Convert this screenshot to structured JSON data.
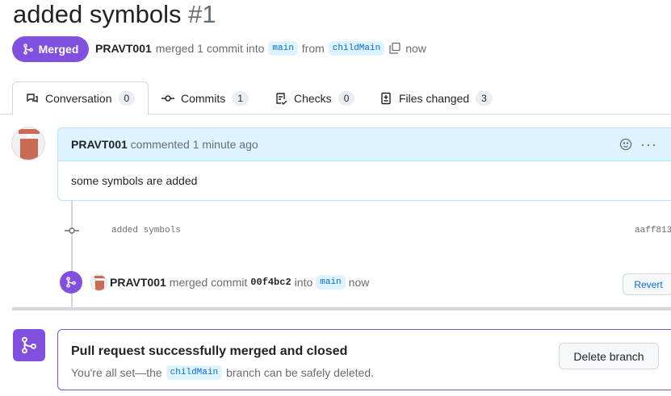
{
  "header": {
    "title": "added symbols",
    "number": "#1",
    "state": "Merged",
    "author": "PRAVT001",
    "summary": "merged 1 commit into",
    "base": "main",
    "from": "from",
    "head": "childMain",
    "time": "now"
  },
  "tabs": [
    {
      "label": "Conversation",
      "count": "0"
    },
    {
      "label": "Commits",
      "count": "1"
    },
    {
      "label": "Checks",
      "count": "0"
    },
    {
      "label": "Files changed",
      "count": "3"
    }
  ],
  "comment": {
    "author": "PRAVT001",
    "action": "commented 1 minute ago",
    "body": "some symbols are added"
  },
  "commit": {
    "message": "added symbols",
    "sha": "aaff813"
  },
  "merge_event": {
    "author": "PRAVT001",
    "text1": "merged commit",
    "sha": "00f4bc2",
    "text2": "into",
    "branch": "main",
    "time": "now",
    "revert": "Revert"
  },
  "merged_box": {
    "title": "Pull request successfully merged and closed",
    "text1": "You're all set—the",
    "branch": "childMain",
    "text2": "branch can be safely deleted.",
    "delete": "Delete branch"
  },
  "colors": {
    "merged": "#8250df",
    "link": "#0969da"
  }
}
